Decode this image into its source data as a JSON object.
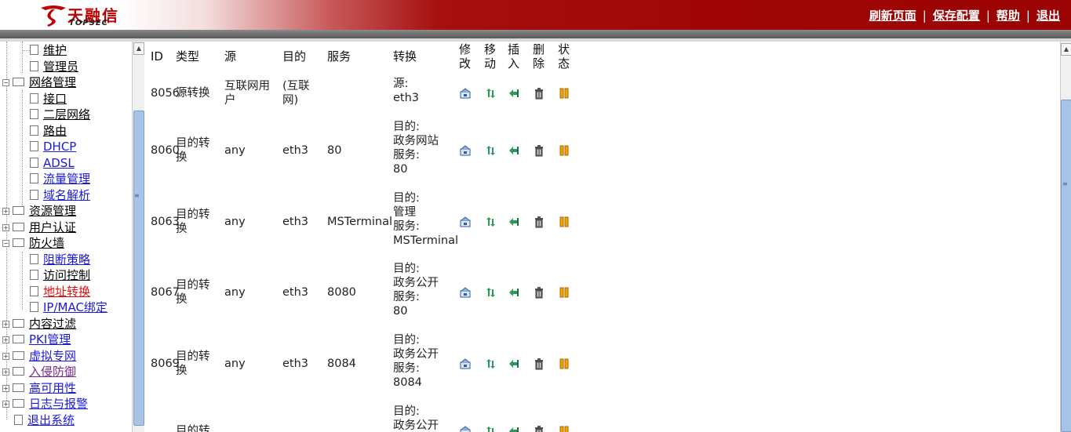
{
  "header": {
    "logo_cn": "天融信",
    "logo_en": "TOPSEC",
    "links": {
      "refresh": "刷新页面",
      "save": "保存配置",
      "help": "帮助",
      "logout": "退出"
    },
    "separator": "|"
  },
  "tree": {
    "items": [
      {
        "label": "维护"
      },
      {
        "label": "管理员"
      },
      {
        "label": "网络管理"
      },
      {
        "label": "接口"
      },
      {
        "label": "二层网络"
      },
      {
        "label": "路由"
      },
      {
        "label": "DHCP"
      },
      {
        "label": "ADSL"
      },
      {
        "label": "流量管理"
      },
      {
        "label": "域名解析"
      },
      {
        "label": "资源管理"
      },
      {
        "label": "用户认证"
      },
      {
        "label": "防火墙"
      },
      {
        "label": "阻断策略"
      },
      {
        "label": "访问控制"
      },
      {
        "label": "地址转换"
      },
      {
        "label": "IP/MAC绑定"
      },
      {
        "label": "内容过滤"
      },
      {
        "label": "PKI管理"
      },
      {
        "label": "虚拟专网"
      },
      {
        "label": "入侵防御"
      },
      {
        "label": "高可用性"
      },
      {
        "label": "日志与报警"
      },
      {
        "label": "退出系统"
      }
    ]
  },
  "table": {
    "headers": {
      "id": "ID",
      "type": "类型",
      "src": "源",
      "dst": "目的",
      "svc": "服务",
      "trans": "转换",
      "edit": [
        "修",
        "改"
      ],
      "move": [
        "移",
        "动"
      ],
      "insert": [
        "插",
        "入"
      ],
      "delete": [
        "删",
        "除"
      ],
      "status": [
        "状",
        "态"
      ]
    },
    "rows": [
      {
        "id": "8056",
        "type": [
          "源转换"
        ],
        "src": [
          "互联网用",
          "户"
        ],
        "dst": [
          "(互联",
          "网)"
        ],
        "svc": "",
        "trans": [
          "源:",
          "eth3"
        ]
      },
      {
        "id": "8060",
        "type": [
          "目的转",
          "换"
        ],
        "src": [
          "any"
        ],
        "dst": [
          "eth3"
        ],
        "svc": "80",
        "trans": [
          "目的:",
          "政务网站",
          "服务:",
          "80"
        ]
      },
      {
        "id": "8063",
        "type": [
          "目的转",
          "换"
        ],
        "src": [
          "any"
        ],
        "dst": [
          "eth3"
        ],
        "svc": "MSTerminal",
        "trans": [
          "目的:",
          "管理",
          "服务:",
          "MSTerminal"
        ]
      },
      {
        "id": "8067",
        "type": [
          "目的转",
          "换"
        ],
        "src": [
          "any"
        ],
        "dst": [
          "eth3"
        ],
        "svc": "8080",
        "trans": [
          "目的:",
          "政务公开",
          "服务:",
          "80"
        ]
      },
      {
        "id": "8069",
        "type": [
          "目的转",
          "换"
        ],
        "src": [
          "any"
        ],
        "dst": [
          "eth3"
        ],
        "svc": "8084",
        "trans": [
          "目的:",
          "政务公开",
          "服务:",
          "8084"
        ]
      },
      {
        "id": "",
        "type": [
          "目的转"
        ],
        "src": [
          ""
        ],
        "dst": [
          ""
        ],
        "svc": "",
        "trans": [
          "目的:",
          "政务公开"
        ]
      }
    ]
  },
  "colors": {
    "header_red": "#a00606",
    "link_blue": "#1a1adb",
    "active_red": "#e01010",
    "scroll_blue": "#a7c3e6"
  },
  "icons": [
    "edit-icon",
    "move-icon",
    "insert-icon",
    "delete-icon",
    "pause-icon"
  ]
}
